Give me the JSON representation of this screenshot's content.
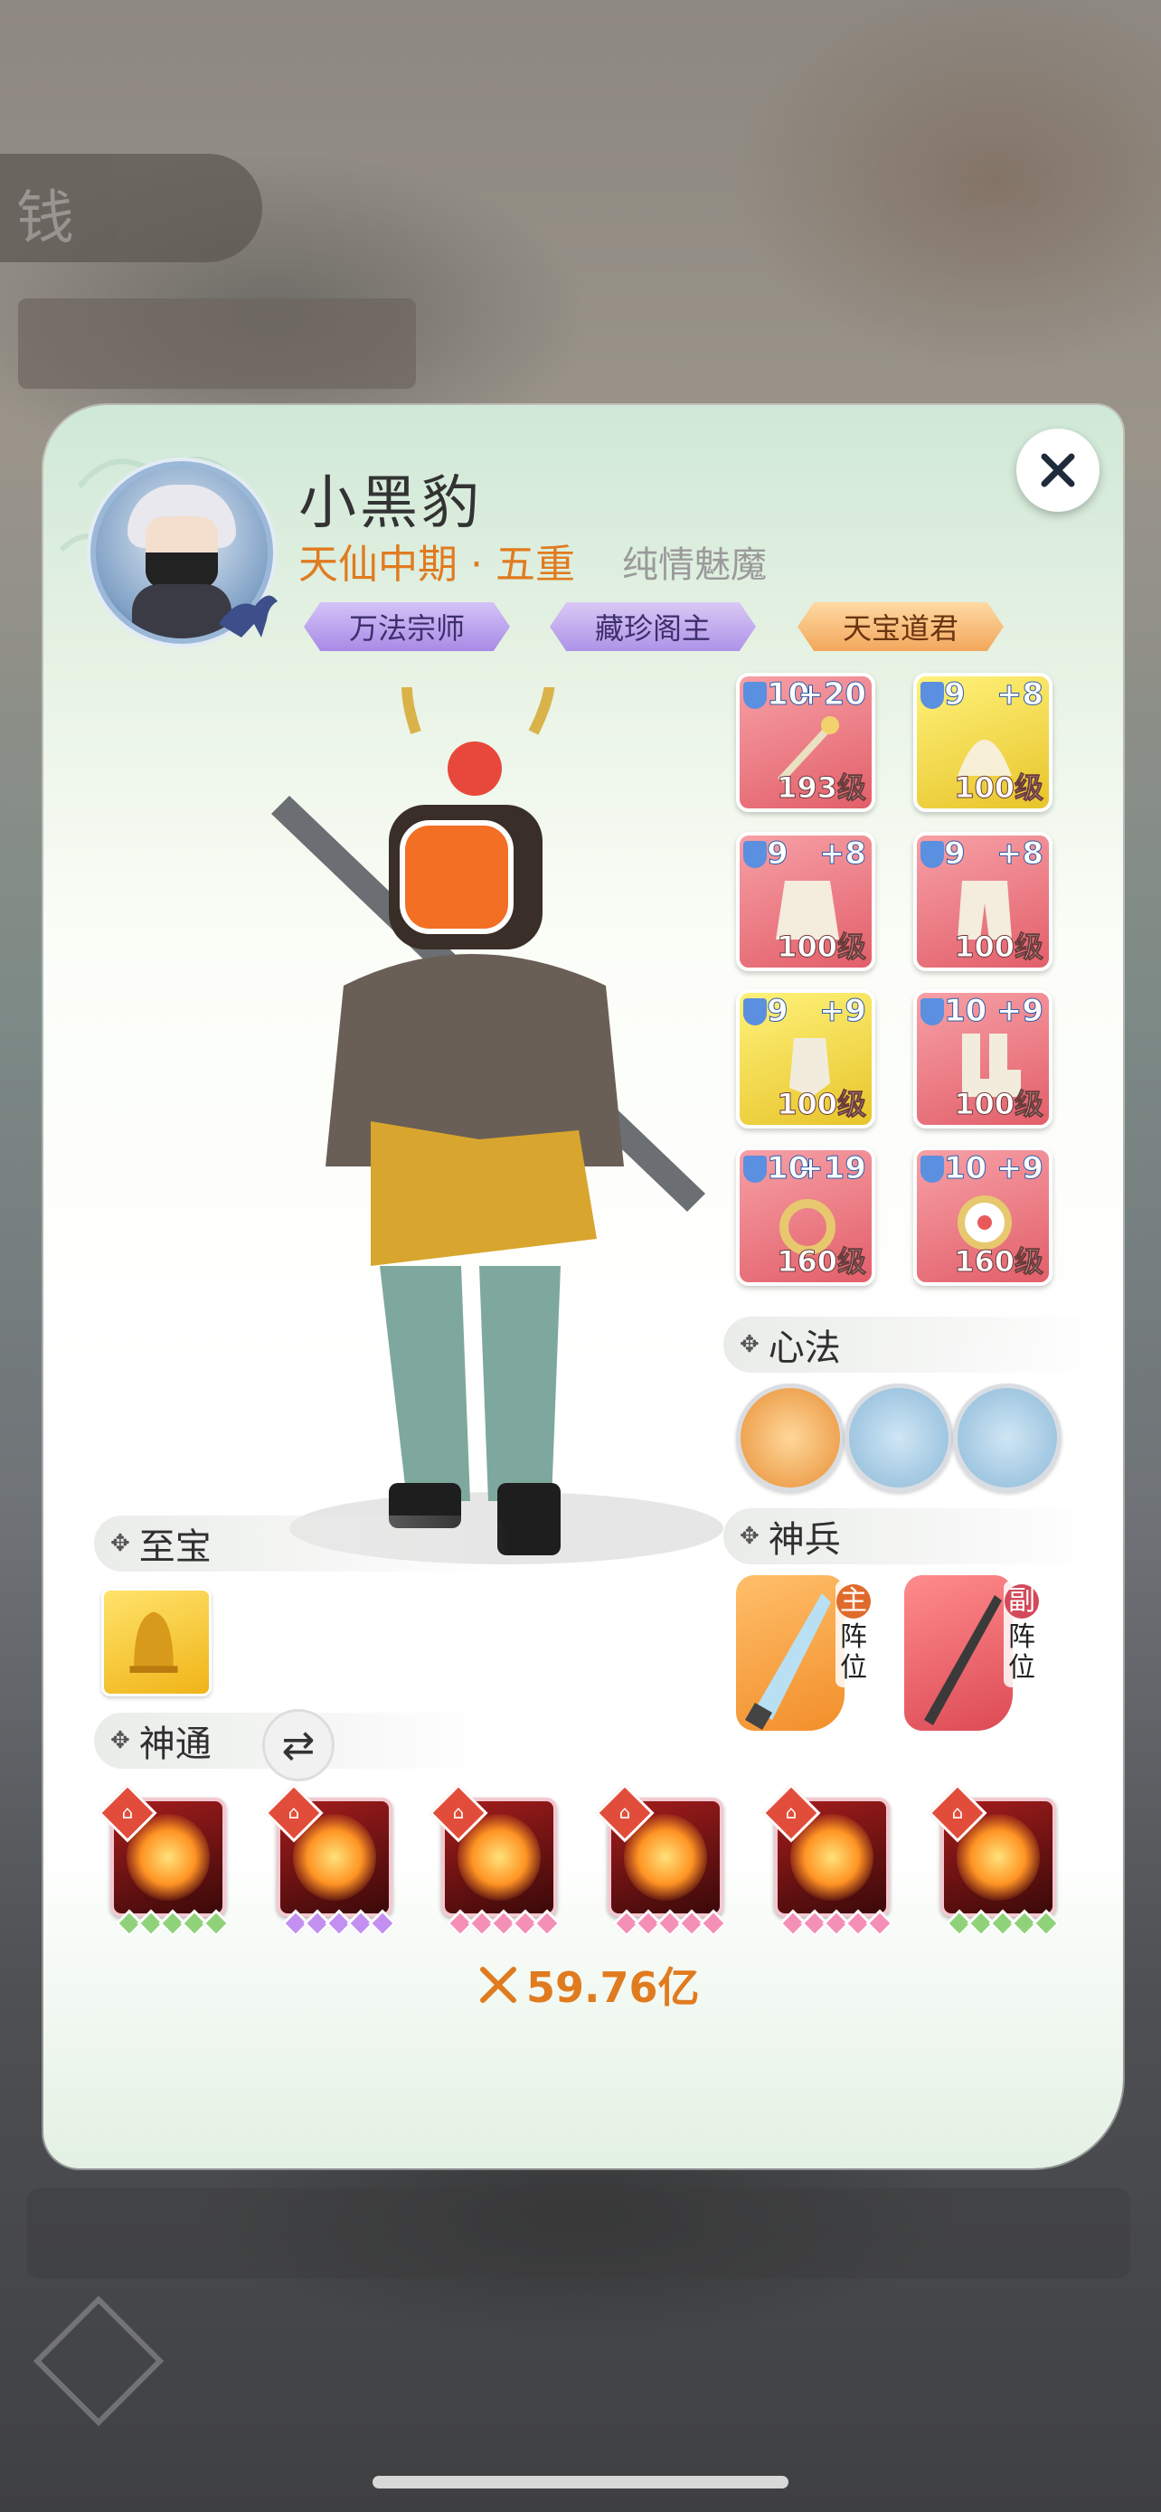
{
  "player": {
    "name": "小黑豹",
    "realm": "天仙中期 · 五重",
    "subtitle": "纯情魅魔",
    "titles": [
      "万法宗师",
      "藏珍阁主",
      "天宝道君"
    ]
  },
  "equipment": [
    {
      "tier": "10",
      "plus": "+20",
      "level": "193级",
      "rarity": "red"
    },
    {
      "tier": "9",
      "plus": "+8",
      "level": "100级",
      "rarity": "gold"
    },
    {
      "tier": "9",
      "plus": "+8",
      "level": "100级",
      "rarity": "red"
    },
    {
      "tier": "9",
      "plus": "+8",
      "level": "100级",
      "rarity": "red"
    },
    {
      "tier": "9",
      "plus": "+9",
      "level": "100级",
      "rarity": "gold"
    },
    {
      "tier": "10",
      "plus": "+9",
      "level": "100级",
      "rarity": "red"
    },
    {
      "tier": "10",
      "plus": "+19",
      "level": "160级",
      "rarity": "red"
    },
    {
      "tier": "10",
      "plus": "+9",
      "level": "160级",
      "rarity": "red"
    }
  ],
  "sections": {
    "xinfa": "心法",
    "shenbing": "神兵",
    "zhibao": "至宝",
    "shentong": "神通"
  },
  "weapons": {
    "main_key": "主",
    "main_pos": "阵位",
    "sub_key": "副",
    "sub_pos": "阵位"
  },
  "skills": [
    {
      "icon": "lotus-fire-icon",
      "star_color": "green",
      "stars": 5
    },
    {
      "icon": "phoenix-fire-icon",
      "star_color": "purple",
      "stars": 5
    },
    {
      "icon": "fire-beast-icon",
      "star_color": "pink",
      "stars": 5
    },
    {
      "icon": "fire-pagoda-icon",
      "star_color": "pink",
      "stars": 5
    },
    {
      "icon": "fire-buddha-icon",
      "star_color": "pink",
      "stars": 5
    },
    {
      "icon": "fire-swirl-icon",
      "star_color": "green",
      "stars": 5
    }
  ],
  "power": "59.76亿",
  "colors": {
    "accent_orange": "#e07b1f",
    "equip_red": "#e25f6a",
    "equip_gold": "#e7c42a"
  }
}
